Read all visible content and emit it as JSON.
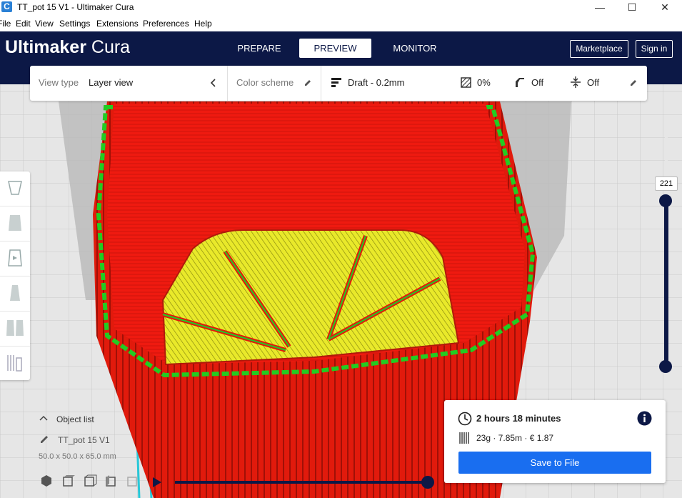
{
  "window": {
    "title": "TT_pot 15 V1  - Ultimaker Cura",
    "app_icon": "C",
    "minimize_icon": "—",
    "maximize_icon": "☐",
    "close_icon": "✕"
  },
  "menu": [
    "File",
    "Edit",
    "View",
    "Settings",
    "Extensions",
    "Preferences",
    "Help"
  ],
  "header": {
    "logo_bold": "Ultimaker",
    "logo_light": " Cura",
    "stages": [
      "PREPARE",
      "PREVIEW",
      "MONITOR"
    ],
    "active_stage": "PREVIEW",
    "marketplace_label": "Marketplace",
    "signin_label": "Sign in"
  },
  "view_bar": {
    "view_type_label": "View type",
    "view_type_value": "Layer view",
    "color_scheme_label": "Color scheme",
    "profile": "Draft - 0.2mm",
    "infill": "0%",
    "support": "Off",
    "adhesion": "Off"
  },
  "layer_slider": {
    "current_layer": "221"
  },
  "object_list": {
    "title": "Object list",
    "object_name": "TT_pot 15 V1",
    "dimensions": "50.0 x 50.0 x 65.0 mm"
  },
  "print_info": {
    "time": "2 hours 18 minutes",
    "material": "23g · 7.85m · € 1.87",
    "save_label": "Save to File"
  },
  "colors": {
    "header_bg": "#0c1846",
    "accent_blue": "#196ef0",
    "wall_red": "#e11a0c",
    "infill_yellow": "#e9e92a",
    "skin_green": "#22cc22"
  }
}
